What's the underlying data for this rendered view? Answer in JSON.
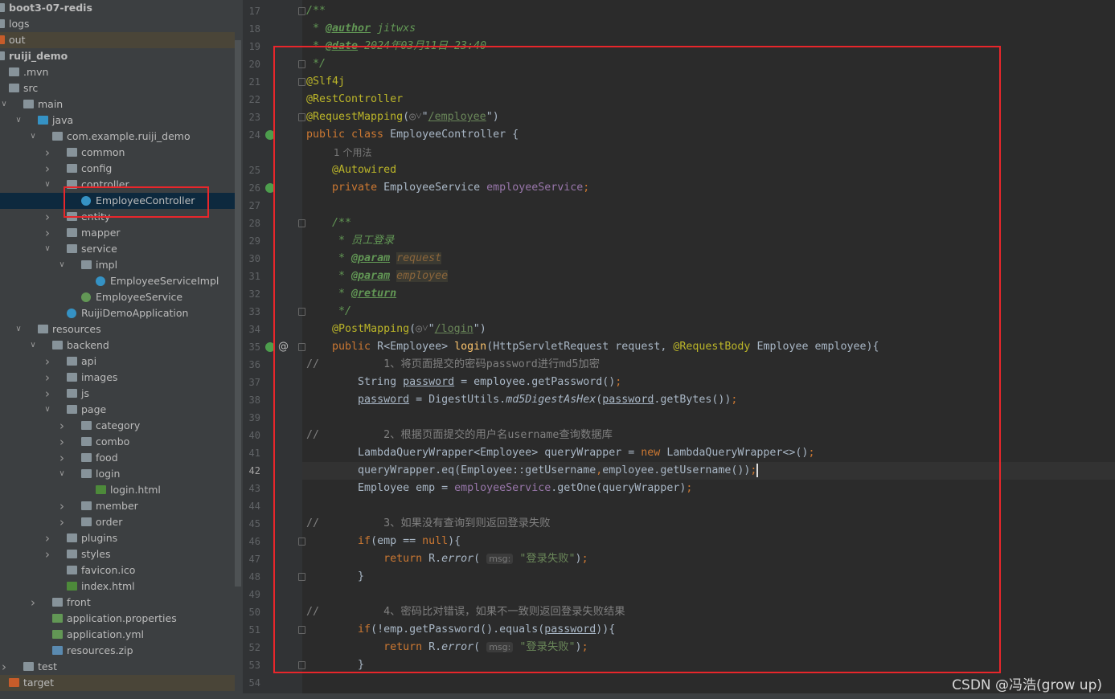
{
  "project_tree": [
    {
      "label": "boot3-07-redis",
      "depth": 0,
      "icon": "module",
      "bold": true
    },
    {
      "label": "logs",
      "depth": 0,
      "icon": "folder"
    },
    {
      "label": "out",
      "depth": 0,
      "icon": "folder-excluded",
      "excluded": true
    },
    {
      "label": "ruiji_demo",
      "depth": 0,
      "icon": "module",
      "bold": true
    },
    {
      "label": ".mvn",
      "depth": 1,
      "icon": "folder"
    },
    {
      "label": "src",
      "depth": 1,
      "icon": "folder",
      "arrow": "open"
    },
    {
      "label": "main",
      "depth": 2,
      "icon": "folder",
      "arrow": "open"
    },
    {
      "label": "java",
      "depth": 3,
      "icon": "folder-source",
      "arrow": "open"
    },
    {
      "label": "com.example.ruiji_demo",
      "depth": 4,
      "icon": "package",
      "arrow": "open"
    },
    {
      "label": "common",
      "depth": 5,
      "icon": "package",
      "arrow": "closed"
    },
    {
      "label": "config",
      "depth": 5,
      "icon": "package",
      "arrow": "closed"
    },
    {
      "label": "controller",
      "depth": 5,
      "icon": "package",
      "arrow": "open"
    },
    {
      "label": "EmployeeController",
      "depth": 6,
      "icon": "class",
      "selected": true
    },
    {
      "label": "entity",
      "depth": 5,
      "icon": "package",
      "arrow": "closed"
    },
    {
      "label": "mapper",
      "depth": 5,
      "icon": "package",
      "arrow": "closed"
    },
    {
      "label": "service",
      "depth": 5,
      "icon": "package",
      "arrow": "open"
    },
    {
      "label": "impl",
      "depth": 6,
      "icon": "package",
      "arrow": "open"
    },
    {
      "label": "EmployeeServiceImpl",
      "depth": 7,
      "icon": "class"
    },
    {
      "label": "EmployeeService",
      "depth": 6,
      "icon": "interface"
    },
    {
      "label": "RuijiDemoApplication",
      "depth": 5,
      "icon": "spring-class"
    },
    {
      "label": "resources",
      "depth": 3,
      "icon": "folder-resources",
      "arrow": "open"
    },
    {
      "label": "backend",
      "depth": 4,
      "icon": "folder",
      "arrow": "open"
    },
    {
      "label": "api",
      "depth": 5,
      "icon": "folder",
      "arrow": "closed"
    },
    {
      "label": "images",
      "depth": 5,
      "icon": "folder",
      "arrow": "closed"
    },
    {
      "label": "js",
      "depth": 5,
      "icon": "folder",
      "arrow": "closed"
    },
    {
      "label": "page",
      "depth": 5,
      "icon": "folder",
      "arrow": "open"
    },
    {
      "label": "category",
      "depth": 6,
      "icon": "folder",
      "arrow": "closed"
    },
    {
      "label": "combo",
      "depth": 6,
      "icon": "folder",
      "arrow": "closed"
    },
    {
      "label": "food",
      "depth": 6,
      "icon": "folder",
      "arrow": "closed"
    },
    {
      "label": "login",
      "depth": 6,
      "icon": "folder",
      "arrow": "open"
    },
    {
      "label": "login.html",
      "depth": 7,
      "icon": "html"
    },
    {
      "label": "member",
      "depth": 6,
      "icon": "folder",
      "arrow": "closed"
    },
    {
      "label": "order",
      "depth": 6,
      "icon": "folder",
      "arrow": "closed"
    },
    {
      "label": "plugins",
      "depth": 5,
      "icon": "folder",
      "arrow": "closed"
    },
    {
      "label": "styles",
      "depth": 5,
      "icon": "folder",
      "arrow": "closed"
    },
    {
      "label": "favicon.ico",
      "depth": 5,
      "icon": "image"
    },
    {
      "label": "index.html",
      "depth": 5,
      "icon": "html"
    },
    {
      "label": "front",
      "depth": 4,
      "icon": "folder",
      "arrow": "closed"
    },
    {
      "label": "application.properties",
      "depth": 4,
      "icon": "spring-config"
    },
    {
      "label": "application.yml",
      "depth": 4,
      "icon": "spring-config"
    },
    {
      "label": "resources.zip",
      "depth": 4,
      "icon": "archive"
    },
    {
      "label": "test",
      "depth": 2,
      "icon": "folder",
      "arrow": "closed"
    },
    {
      "label": "target",
      "depth": 1,
      "icon": "folder-excluded",
      "excluded": true
    }
  ],
  "editor": {
    "current_line": 42,
    "lines": [
      {
        "n": 17,
        "seg": [
          [
            "/**",
            "jd"
          ]
        ]
      },
      {
        "n": 18,
        "seg": [
          [
            " * ",
            "jd"
          ],
          [
            "@author",
            "jt"
          ],
          [
            " jitwxs",
            "jd"
          ]
        ]
      },
      {
        "n": 19,
        "seg": [
          [
            " * ",
            "jd"
          ],
          [
            "@date",
            "jt"
          ],
          [
            " 2024年03月11日 23:40",
            "jd"
          ]
        ]
      },
      {
        "n": 20,
        "seg": [
          [
            " */",
            "jd"
          ]
        ]
      },
      {
        "n": 21,
        "seg": [
          [
            "@Slf4j",
            "an"
          ]
        ]
      },
      {
        "n": 22,
        "seg": [
          [
            "@RestController",
            "an"
          ]
        ]
      },
      {
        "n": 23,
        "seg": [
          [
            "@RequestMapping",
            "an"
          ],
          [
            "(",
            ""
          ],
          [
            "◎˅",
            "cm"
          ],
          [
            "\"",
            ""
          ],
          [
            "/employee",
            "url"
          ],
          [
            "\")",
            ""
          ]
        ]
      },
      {
        "n": 24,
        "seg": [
          [
            "public class ",
            "kw"
          ],
          [
            "EmployeeController {",
            ""
          ]
        ]
      },
      {
        "inlay": "1 个用法",
        "indent": 1
      },
      {
        "n": 25,
        "seg": [
          [
            "    ",
            ""
          ],
          [
            "@Autowired",
            "an"
          ]
        ]
      },
      {
        "n": 26,
        "seg": [
          [
            "    ",
            ""
          ],
          [
            "private ",
            "kw"
          ],
          [
            "EmployeeService ",
            ""
          ],
          [
            "employeeService",
            "fd"
          ],
          [
            ";",
            "kw"
          ]
        ]
      },
      {
        "n": 27,
        "seg": []
      },
      {
        "n": 28,
        "seg": [
          [
            "    /**",
            "jd"
          ]
        ]
      },
      {
        "n": 29,
        "seg": [
          [
            "     * 员工登录",
            "jd"
          ]
        ]
      },
      {
        "n": 30,
        "seg": [
          [
            "     * ",
            "jd"
          ],
          [
            "@param",
            "jt"
          ],
          [
            " ",
            "jd"
          ],
          [
            "request",
            "jp"
          ]
        ]
      },
      {
        "n": 31,
        "seg": [
          [
            "     * ",
            "jd"
          ],
          [
            "@param",
            "jt"
          ],
          [
            " ",
            "jd"
          ],
          [
            "employee",
            "jp"
          ]
        ]
      },
      {
        "n": 32,
        "seg": [
          [
            "     * ",
            "jd"
          ],
          [
            "@return",
            "jt"
          ]
        ]
      },
      {
        "n": 33,
        "seg": [
          [
            "     */",
            "jd"
          ]
        ]
      },
      {
        "n": 34,
        "seg": [
          [
            "    ",
            ""
          ],
          [
            "@PostMapping",
            "an"
          ],
          [
            "(",
            ""
          ],
          [
            "◎˅",
            "cm"
          ],
          [
            "\"",
            ""
          ],
          [
            "/login",
            "url"
          ],
          [
            "\")",
            ""
          ]
        ]
      },
      {
        "n": 35,
        "seg": [
          [
            "    ",
            ""
          ],
          [
            "public ",
            "kw"
          ],
          [
            "R<Employee> ",
            ""
          ],
          [
            "login",
            "mt"
          ],
          [
            "(HttpServletRequest request, ",
            ""
          ],
          [
            "@RequestBody",
            "an"
          ],
          [
            " Employee employee){",
            ""
          ]
        ]
      },
      {
        "n": 36,
        "seg": [
          [
            "//          1、将页面提交的密码password进行md5加密",
            "cm"
          ]
        ]
      },
      {
        "n": 37,
        "seg": [
          [
            "        String ",
            ""
          ],
          [
            "password",
            "ul"
          ],
          [
            " = employee.getPassword()",
            ""
          ],
          [
            ";",
            "kw"
          ]
        ]
      },
      {
        "n": 38,
        "seg": [
          [
            "        ",
            ""
          ],
          [
            "password",
            "ul"
          ],
          [
            " = DigestUtils.",
            ""
          ],
          [
            "md5DigestAsHex",
            "it"
          ],
          [
            "(",
            ""
          ],
          [
            "password",
            "ul"
          ],
          [
            ".getBytes())",
            ""
          ],
          [
            ";",
            "kw"
          ]
        ]
      },
      {
        "n": 39,
        "seg": []
      },
      {
        "n": 40,
        "seg": [
          [
            "//          2、根据页面提交的用户名username查询数据库",
            "cm"
          ]
        ]
      },
      {
        "n": 41,
        "seg": [
          [
            "        LambdaQueryWrapper<Employee> queryWrapper = ",
            ""
          ],
          [
            "new ",
            "kw"
          ],
          [
            "LambdaQueryWrapper<>()",
            ""
          ],
          [
            ";",
            "kw"
          ]
        ]
      },
      {
        "n": 42,
        "seg": [
          [
            "        queryWrapper.eq(Employee::getUsername",
            ""
          ],
          [
            ",",
            "kw"
          ],
          [
            "employee.getUsername())",
            ""
          ],
          [
            ";",
            "kw"
          ]
        ]
      },
      {
        "n": 43,
        "seg": [
          [
            "        Employee emp = ",
            ""
          ],
          [
            "employeeService",
            "fd"
          ],
          [
            ".getOne(queryWrapper)",
            ""
          ],
          [
            ";",
            "kw"
          ]
        ]
      },
      {
        "n": 44,
        "seg": []
      },
      {
        "n": 45,
        "seg": [
          [
            "//          3、如果没有查询到则返回登录失败",
            "cm"
          ]
        ]
      },
      {
        "n": 46,
        "seg": [
          [
            "        ",
            ""
          ],
          [
            "if",
            "kw"
          ],
          [
            "(emp == ",
            ""
          ],
          [
            "null",
            "kw"
          ],
          [
            "){",
            ""
          ]
        ]
      },
      {
        "n": 47,
        "seg": [
          [
            "            ",
            ""
          ],
          [
            "return ",
            "kw"
          ],
          [
            "R.",
            ""
          ],
          [
            "error",
            "it"
          ],
          [
            "( ",
            ""
          ],
          [
            "msg:",
            "hint"
          ],
          [
            " ",
            ""
          ],
          [
            "\"登录失败\"",
            "st"
          ],
          [
            ")",
            ""
          ],
          [
            ";",
            "kw"
          ]
        ]
      },
      {
        "n": 48,
        "seg": [
          [
            "        }",
            ""
          ]
        ]
      },
      {
        "n": 49,
        "seg": []
      },
      {
        "n": 50,
        "seg": [
          [
            "//          4、密码比对错误，如果不一致则返回登录失败结果",
            "cm"
          ]
        ]
      },
      {
        "n": 51,
        "seg": [
          [
            "        ",
            ""
          ],
          [
            "if",
            "kw"
          ],
          [
            "(!emp.getPassword().equals(",
            ""
          ],
          [
            "password",
            "ul"
          ],
          [
            ")){",
            ""
          ]
        ]
      },
      {
        "n": 52,
        "seg": [
          [
            "            ",
            ""
          ],
          [
            "return ",
            "kw"
          ],
          [
            "R.",
            ""
          ],
          [
            "error",
            "it"
          ],
          [
            "( ",
            ""
          ],
          [
            "msg:",
            "hint"
          ],
          [
            " ",
            ""
          ],
          [
            "\"登录失败\"",
            "st"
          ],
          [
            ")",
            ""
          ],
          [
            ";",
            "kw"
          ]
        ]
      },
      {
        "n": 53,
        "seg": [
          [
            "        }",
            ""
          ]
        ]
      },
      {
        "n": 54,
        "seg": []
      }
    ]
  },
  "annotation_color": "#e8262b",
  "watermark": "CSDN @冯浩(grow up)"
}
